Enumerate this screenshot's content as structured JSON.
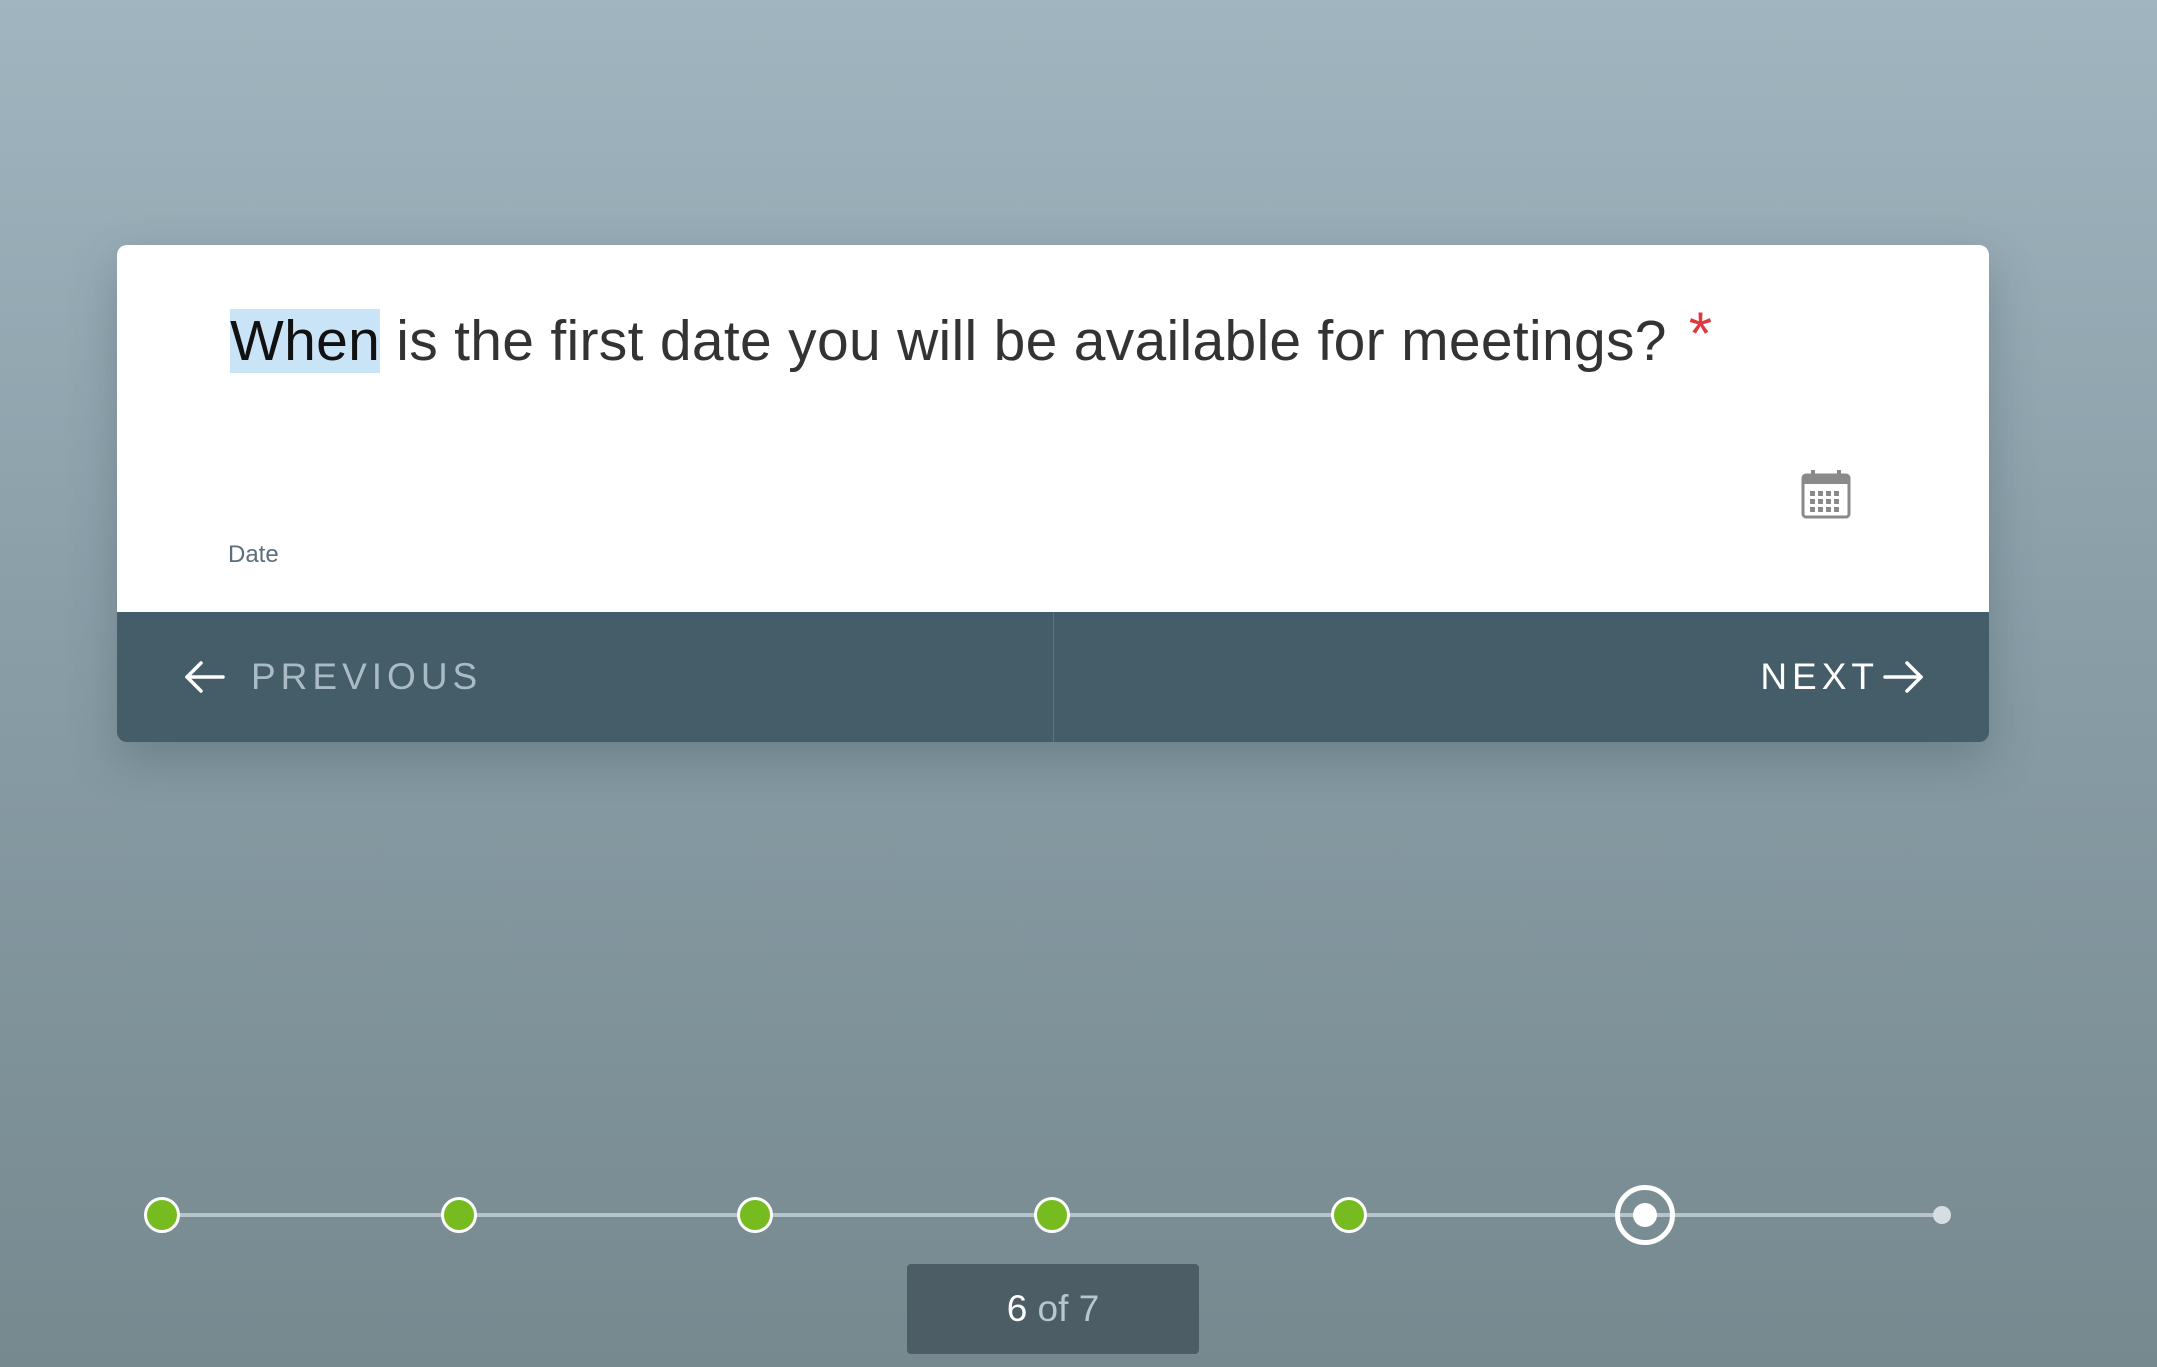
{
  "question": {
    "highlighted_word": "When",
    "rest": " is the first date you will be available for meetings?",
    "required_marker": "*"
  },
  "date_field": {
    "value": "",
    "label": "Date",
    "icon": "calendar-icon"
  },
  "navigation": {
    "previous_label": "PREVIOUS",
    "next_label": "NEXT",
    "previous_icon": "arrow-left-icon",
    "next_icon": "arrow-right-icon"
  },
  "progress": {
    "current": "6",
    "separator": " of ",
    "total": "7",
    "completed_steps": 5,
    "completed_color": "#76bc21"
  },
  "colors": {
    "nav_bar": "#455d69",
    "required": "#e0383e",
    "highlight": "#c9e3f7"
  }
}
